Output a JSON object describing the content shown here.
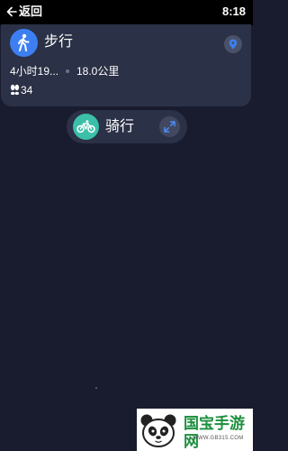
{
  "status_bar": {
    "back_label": "返回",
    "time": "8:18"
  },
  "walk_card": {
    "title": "步行",
    "duration": "4小时19...",
    "distance": "18.0公里",
    "steps": "34",
    "icon": "walking-person-icon",
    "accent_color": "#3d7ff2"
  },
  "bike_card": {
    "title": "骑行",
    "icon": "bicycle-icon",
    "accent_color": "#3bbfa8"
  },
  "watermark": {
    "text": "国宝手游网",
    "url": "WWW.GB315.COM"
  }
}
